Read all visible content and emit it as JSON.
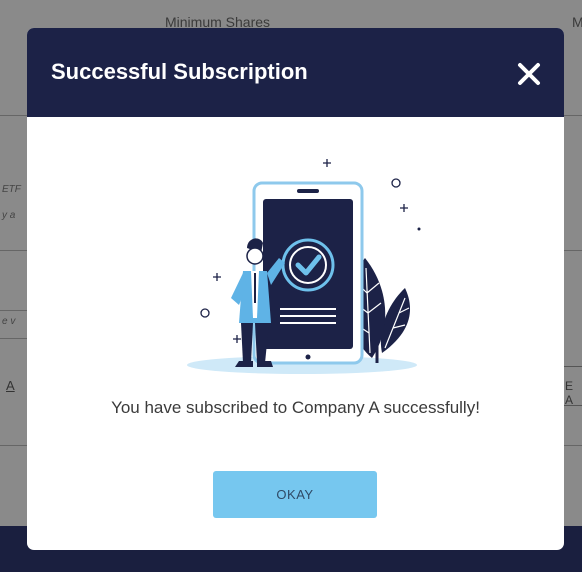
{
  "background": {
    "column_header_1": "Minimum Shares",
    "column_header_2": "M",
    "cell_fragment_1": "ETF",
    "cell_fragment_2": "y a",
    "cell_fragment_3": "e v",
    "link_fragment": "A",
    "right_button_fragment": "E A"
  },
  "modal": {
    "title": "Successful Subscription",
    "close_icon": "close-icon",
    "illustration": "person-with-phone-checkmark-illustration",
    "message": "You have subscribed to Company A successfully!",
    "okay_label": "OKAY"
  },
  "colors": {
    "header_bg": "#1c2247",
    "button_bg": "#76c7ef",
    "accent": "#4aa3df"
  }
}
